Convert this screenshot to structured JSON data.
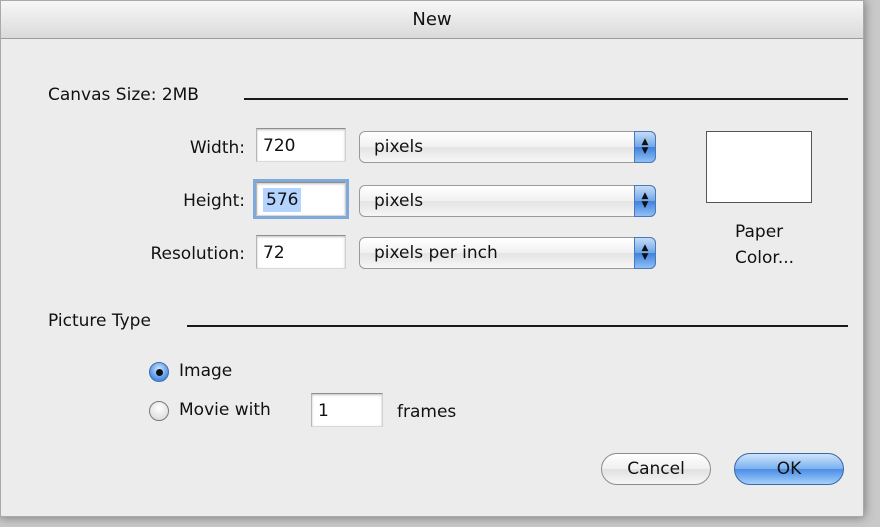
{
  "window": {
    "title": "New"
  },
  "canvas_size": {
    "label": "Canvas Size: 2MB",
    "width": {
      "label": "Width:",
      "value": "720",
      "unit": "pixels"
    },
    "height": {
      "label": "Height:",
      "value": "576",
      "unit": "pixels"
    },
    "resolution": {
      "label": "Resolution:",
      "value": "72",
      "unit": "pixels per inch"
    }
  },
  "paper_color": {
    "line1": "Paper",
    "line2": "Color...",
    "color": "#ffffff"
  },
  "picture_type": {
    "label": "Picture Type",
    "image_label": "Image",
    "movie_label": "Movie with",
    "frames_value": "1",
    "frames_label": "frames",
    "selected": "Image"
  },
  "buttons": {
    "cancel": "Cancel",
    "ok": "OK"
  },
  "colors": {
    "default_button": "#4a8ce6",
    "selection": "#b5d3ff"
  }
}
